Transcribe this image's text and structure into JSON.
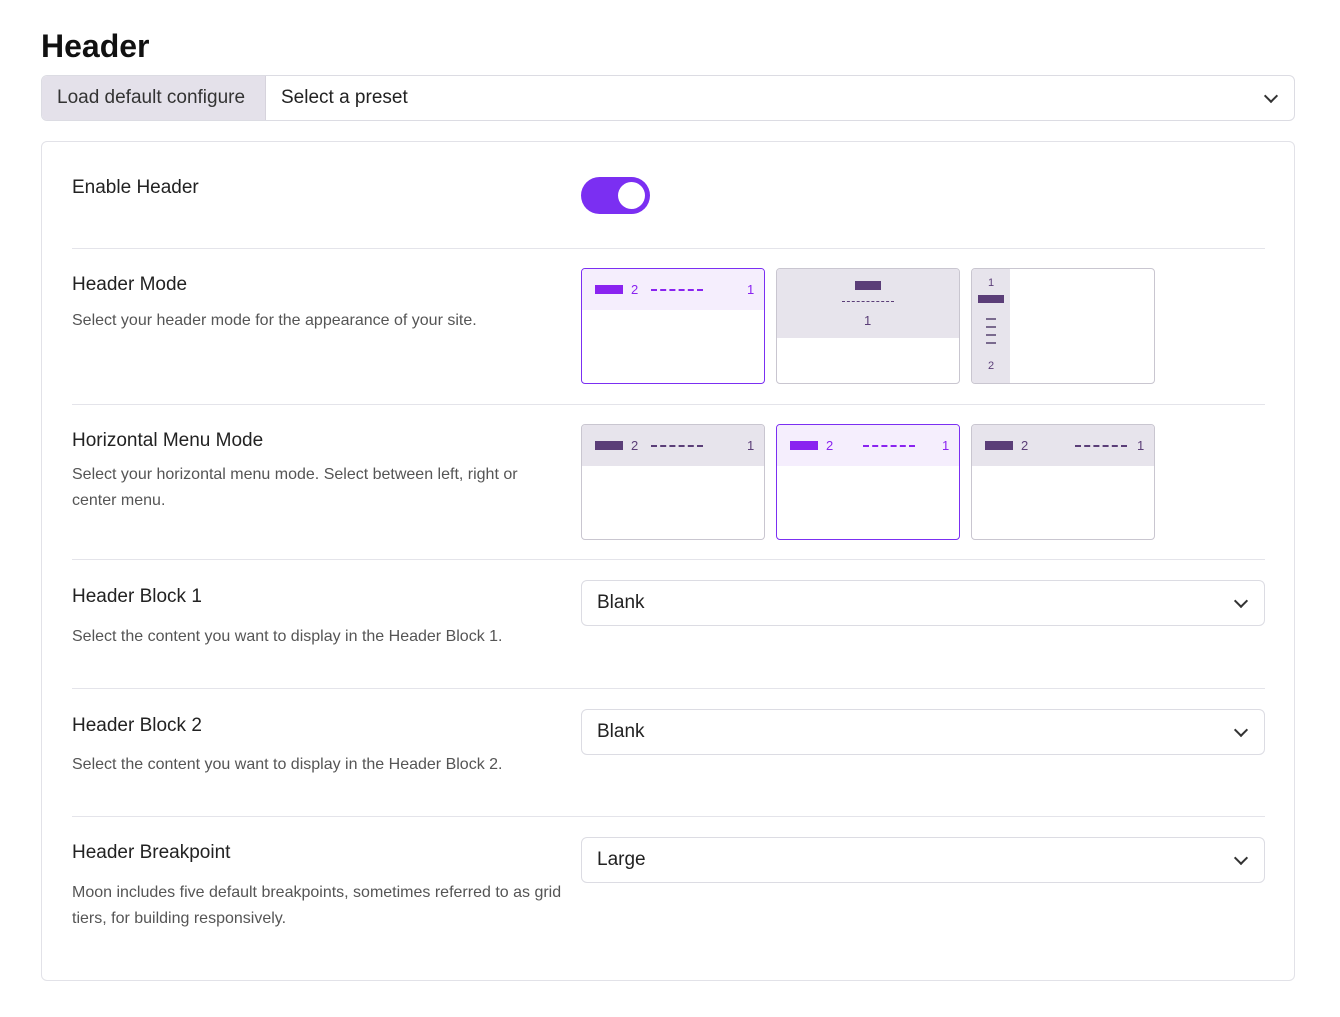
{
  "page": {
    "title": "Header"
  },
  "preset": {
    "load_label": "Load default configure",
    "select_value": "Select a preset"
  },
  "colors": {
    "accent": "#7b2ff2",
    "option_dark": "#5b3e78",
    "option_light": "#8a23f0"
  },
  "rows": {
    "enable_header": {
      "label": "Enable Header",
      "enabled": true
    },
    "header_mode": {
      "label": "Header Mode",
      "description": "Select your header mode for the appearance of your site.",
      "options": [
        {
          "name": "horizontal",
          "block": "2",
          "num": "1",
          "selected": true
        },
        {
          "name": "centered",
          "num": "1",
          "selected": false
        },
        {
          "name": "vertical",
          "top_num": "1",
          "bottom_num": "2",
          "selected": false
        }
      ]
    },
    "menu_mode": {
      "label": "Horizontal Menu Mode",
      "description": "Select your horizontal menu mode. Select between left, right or center menu.",
      "options": [
        {
          "name": "left",
          "block": "2",
          "num": "1",
          "selected": false
        },
        {
          "name": "center",
          "block": "2",
          "num": "1",
          "selected": true
        },
        {
          "name": "right",
          "block": "2",
          "num": "1",
          "selected": false
        }
      ]
    },
    "block1": {
      "label": "Header Block 1",
      "description": "Select the content you want to display in the Header Block 1.",
      "value": "Blank"
    },
    "block2": {
      "label": "Header Block 2",
      "description": "Select the content you want to display in the Header Block 2.",
      "value": "Blank"
    },
    "breakpoint": {
      "label": "Header Breakpoint",
      "description": "Moon includes five default breakpoints, sometimes referred to as grid tiers, for building responsively.",
      "value": "Large"
    }
  }
}
